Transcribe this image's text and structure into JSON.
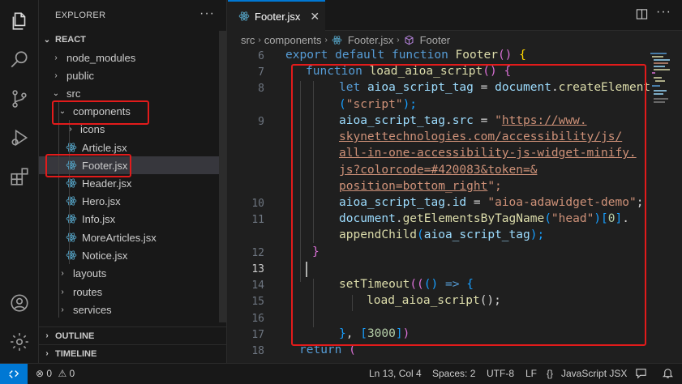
{
  "activity_bar": {
    "items": [
      "explorer-icon",
      "search-icon",
      "source-control-icon",
      "run-debug-icon",
      "extensions-icon"
    ],
    "bottom": [
      "account-icon",
      "settings-gear-icon"
    ]
  },
  "sidebar": {
    "title": "EXPLORER",
    "more": "···",
    "root": "REACT",
    "tree": [
      {
        "label": "node_modules",
        "chevron": "›"
      },
      {
        "label": "public",
        "chevron": "›"
      },
      {
        "label": "src",
        "chevron": "⌄"
      },
      {
        "label": "components",
        "chevron": "⌄"
      },
      {
        "label": "icons",
        "chevron": "›"
      },
      {
        "label": "Article.jsx"
      },
      {
        "label": "Footer.jsx"
      },
      {
        "label": "Header.jsx"
      },
      {
        "label": "Hero.jsx"
      },
      {
        "label": "Info.jsx"
      },
      {
        "label": "MoreArticles.jsx"
      },
      {
        "label": "Notice.jsx"
      },
      {
        "label": "layouts",
        "chevron": "›"
      },
      {
        "label": "routes",
        "chevron": "›"
      },
      {
        "label": "services",
        "chevron": "›"
      }
    ],
    "outline": "OUTLINE",
    "timeline": "TIMELINE",
    "chevron_collapsed": "›"
  },
  "tab": {
    "label": "Footer.jsx",
    "close": "✕"
  },
  "breadcrumb": {
    "items": [
      "src",
      "components",
      "Footer.jsx",
      "Footer"
    ],
    "sep": "›"
  },
  "line_numbers": [
    "6",
    "7",
    "8",
    "9",
    "10",
    "11",
    "12",
    "13",
    "14",
    "15",
    "16",
    "17",
    "18"
  ],
  "code": {
    "l6": {
      "a": "export",
      "b": "default",
      "c": "function",
      "d": "Footer",
      "e": "()",
      "f": "{"
    },
    "l7": {
      "a": "function",
      "b": "load_aioa_script",
      "c": "()",
      "d": "{"
    },
    "l8a": {
      "a": "let",
      "b": "aioa_script_tag",
      "c": "=",
      "d": "document",
      "e": ".",
      "f": "createElement"
    },
    "l8b": {
      "a": "(",
      "b": "\"script\"",
      "c": ");"
    },
    "l9a": {
      "a": "aioa_script_tag",
      "b": ".",
      "c": "src",
      "d": "=",
      "e": "\"",
      "f": "https://www."
    },
    "l9b": "skynettechnologies.com/accessibility/js/",
    "l9c": "all-in-one-accessibility-js-widget-minify.",
    "l9d": "js?colorcode=#420083&token=&",
    "l9e": {
      "a": "position=bottom_right",
      "b": "\";"
    },
    "l10": {
      "a": "aioa_script_tag",
      "b": ".",
      "c": "id",
      "d": "=",
      "e": "\"aioa-adawidget-demo\"",
      "f": ";"
    },
    "l11a": {
      "a": "document",
      "b": ".",
      "c": "getElementsByTagName",
      "d": "(",
      "e": "\"head\"",
      "f": ")",
      "g": "[",
      "h": "0",
      "i": "]",
      "j": "."
    },
    "l11b": {
      "a": "appendChild",
      "b": "(",
      "c": "aioa_script_tag",
      "d": ");"
    },
    "l12": "}",
    "l14": {
      "a": "setTimeout",
      "b": "((",
      "c": "()",
      "d": "=>",
      "e": "{"
    },
    "l15": {
      "a": "load_aioa_script",
      "b": "();"
    },
    "l17": {
      "a": "}",
      "b": ",",
      "c": "[",
      "d": "3000",
      "e": "]",
      "f": ")"
    },
    "l18": {
      "a": "return",
      "b": "("
    }
  },
  "status_bar": {
    "errors": "0",
    "warnings": "0",
    "position": "Ln 13, Col 4",
    "spaces": "Spaces: 2",
    "encoding": "UTF-8",
    "eol": "LF",
    "braces": "{}",
    "language": "JavaScript JSX"
  },
  "colors": {
    "accent": "#0078d4",
    "highlight_box": "#e21b1b",
    "keyword": "#569cd6",
    "function": "#dcdcaa",
    "string": "#ce9178"
  }
}
